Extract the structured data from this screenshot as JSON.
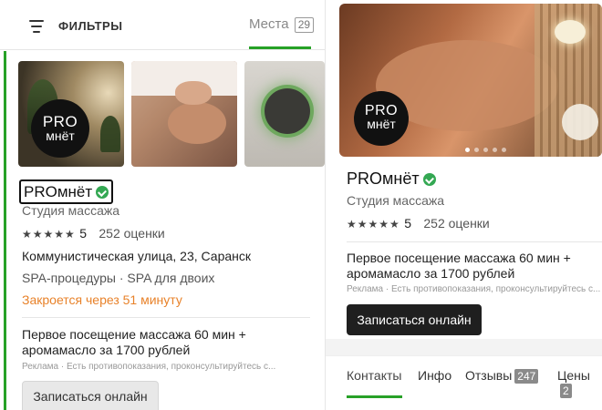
{
  "left": {
    "filters_label": "ФИЛЬТРЫ",
    "places_tab": "Места",
    "places_count": "29",
    "business": {
      "name": "PROмнёт",
      "logo_line1": "PRO",
      "logo_line2": "мнёт",
      "category": "Студия массажа",
      "stars": "★★★★★",
      "rating": "5",
      "reviews": "252 оценки",
      "address": "Коммунистическая улица, 23, Саранск",
      "tags": "SPA-процедуры · SPA для двоих",
      "closing": "Закроется через 51 минуту",
      "promo": "Первое посещение массажа 60 мин + аромамасло за 1700 рублей",
      "ad_note": "Реклама · Есть противопоказания, проконсультируйтесь с...",
      "book_button": "Записаться онлайн"
    }
  },
  "right": {
    "name": "PROмнёт",
    "logo_line1": "PRO",
    "logo_line2": "мнёт",
    "category": "Студия массажа",
    "stars": "★★★★★",
    "rating": "5",
    "reviews": "252 оценки",
    "promo": "Первое посещение массажа 60 мин + аромамасло за 1700 рублей",
    "ad_note": "Реклама · Есть противопоказания, проконсультируйтесь с...",
    "book_button": "Записаться онлайн",
    "tabs": [
      {
        "label": "Контакты"
      },
      {
        "label": "Инфо"
      },
      {
        "label": "Отзывы",
        "count": "247"
      },
      {
        "label": "Цены",
        "count": "2"
      }
    ]
  },
  "colors": {
    "accent_green": "#27a127",
    "closing_orange": "#e8822a",
    "book_dark": "#1f1f1f"
  }
}
